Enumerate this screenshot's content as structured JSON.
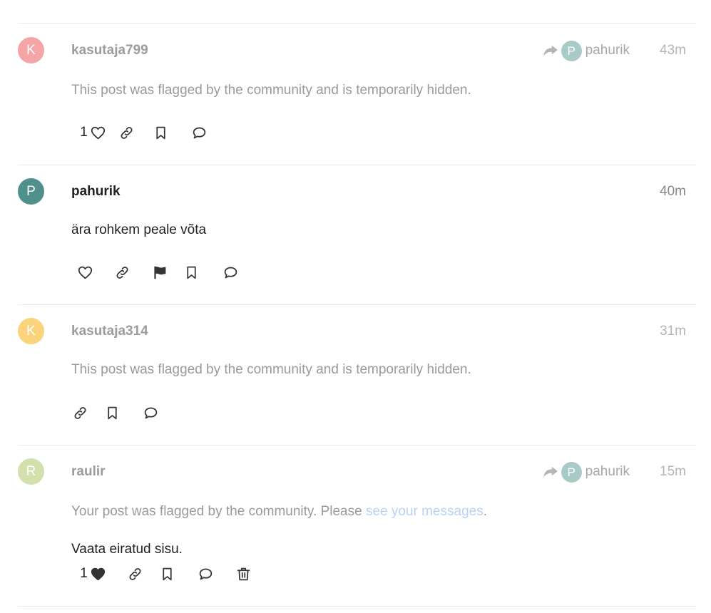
{
  "posts": [
    {
      "avatar_letter": "K",
      "avatar_color": "#f5a5a8",
      "username": "kasutaja799",
      "reply_to": {
        "avatar_letter": "P",
        "username": "pahurik"
      },
      "time": "43m",
      "body": "This post was flagged by the community and is temporarily hidden.",
      "like_count": "1"
    },
    {
      "avatar_letter": "P",
      "avatar_color": "#4f8f8c",
      "username": "pahurik",
      "time": "40m",
      "body": "ära rohkem peale võta"
    },
    {
      "avatar_letter": "K",
      "avatar_color": "#fbd37c",
      "username": "kasutaja314",
      "time": "31m",
      "body": "This post was flagged by the community and is temporarily hidden."
    },
    {
      "avatar_letter": "R",
      "avatar_color": "#d3e0ae",
      "username": "raulir",
      "reply_to": {
        "avatar_letter": "P",
        "username": "pahurik"
      },
      "time": "15m",
      "body_prefix": "Your post was flagged by the community. Please ",
      "body_link": "see your messages",
      "body_suffix": ".",
      "view_ignored": "Vaata eiratud sisu.",
      "like_count": "1"
    }
  ],
  "icons": {
    "like": "heart-icon",
    "liked": "heart-filled-icon",
    "link": "link-icon",
    "bookmark": "bookmark-icon",
    "reply": "reply-icon",
    "flag": "flag-icon",
    "delete": "trash-icon",
    "reply_to": "share-arrow-icon"
  }
}
